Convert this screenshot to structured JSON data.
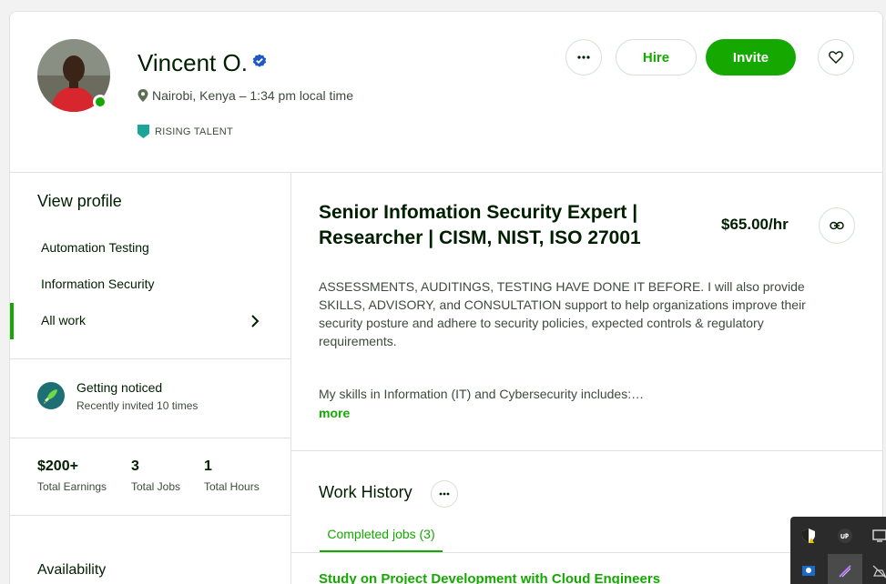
{
  "profile": {
    "name": "Vincent O.",
    "location": "Nairobi, Kenya – 1:34 pm local time",
    "badge": "RISING TALENT"
  },
  "actions": {
    "hire_label": "Hire",
    "invite_label": "Invite"
  },
  "sidebar": {
    "view_profile": "View profile",
    "items": [
      {
        "label": "Automation Testing"
      },
      {
        "label": "Information Security"
      },
      {
        "label": "All work"
      }
    ],
    "notice": {
      "title": "Getting noticed",
      "subtitle": "Recently invited 10 times"
    },
    "stats": [
      {
        "value": "$200+",
        "label": "Total Earnings"
      },
      {
        "value": "3",
        "label": "Total Jobs"
      },
      {
        "value": "1",
        "label": "Total Hours"
      }
    ],
    "availability": "Availability"
  },
  "main": {
    "title": "Senior Infomation Security Expert | Researcher | CISM, NIST, ISO 27001",
    "rate": "$65.00/hr",
    "description": "ASSESSMENTS, AUDITINGS, TESTING HAVE DONE IT BEFORE. I will also provide SKILLS, ADVISORY, and CONSULTATION support to help organizations improve their security posture and adhere to security policies, expected controls & regulatory requirements.",
    "skills_intro": "My skills in Information (IT) and Cybersecurity includes:…",
    "more_label": "more",
    "work_history_title": "Work History",
    "tab_completed": "Completed jobs (3)",
    "first_job": "Study on Project Development with Cloud Engineers"
  },
  "colors": {
    "brand_green": "#14a800",
    "verified_blue": "#108a00",
    "badge_teal": "#1ea59a"
  },
  "icons": [
    "more-icon",
    "heart-icon",
    "location-pin-icon",
    "verified-icon",
    "rising-talent-icon",
    "chevron-right-icon",
    "rocket-icon",
    "link-icon"
  ]
}
